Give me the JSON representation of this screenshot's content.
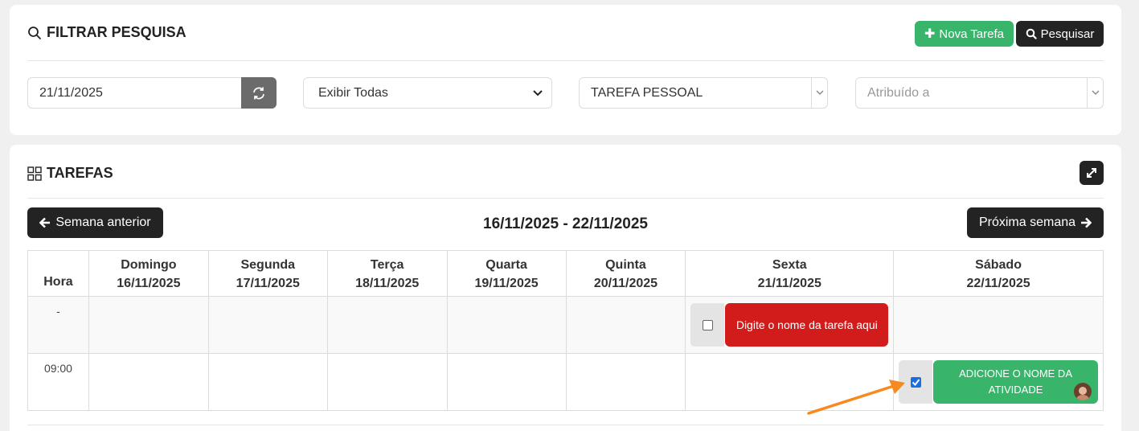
{
  "filter": {
    "title": "FILTRAR PESQUISA",
    "new_task_label": "Nova Tarefa",
    "search_label": "Pesquisar",
    "date_value": "21/11/2025",
    "show_select_value": "Exibir Todas",
    "type_select_value": "TAREFA PESSOAL",
    "assigned_placeholder": "Atribuído a"
  },
  "tasks": {
    "title": "TAREFAS",
    "prev_week_label": "Semana anterior",
    "next_week_label": "Próxima semana",
    "week_range": "16/11/2025 - 22/11/2025",
    "hour_header": "Hora",
    "days": [
      {
        "name": "Domingo",
        "date": "16/11/2025"
      },
      {
        "name": "Segunda",
        "date": "17/11/2025"
      },
      {
        "name": "Terça",
        "date": "18/11/2025"
      },
      {
        "name": "Quarta",
        "date": "19/11/2025"
      },
      {
        "name": "Quinta",
        "date": "20/11/2025"
      },
      {
        "name": "Sexta",
        "date": "21/11/2025"
      },
      {
        "name": "Sábado",
        "date": "22/11/2025"
      }
    ],
    "rows": [
      {
        "hour": "-"
      },
      {
        "hour": "09:00"
      }
    ],
    "items": [
      {
        "text": "Digite o nome da tarefa aqui",
        "checked": false,
        "color": "#d21c1c"
      },
      {
        "text": "ADICIONE O NOME DA ATIVIDADE",
        "checked": true,
        "color": "#38b56a"
      }
    ]
  },
  "colors": {
    "accent_green": "#38b56a",
    "dark_button": "#232323",
    "task_red": "#d21c1c",
    "annotation_arrow": "#f7891f"
  }
}
